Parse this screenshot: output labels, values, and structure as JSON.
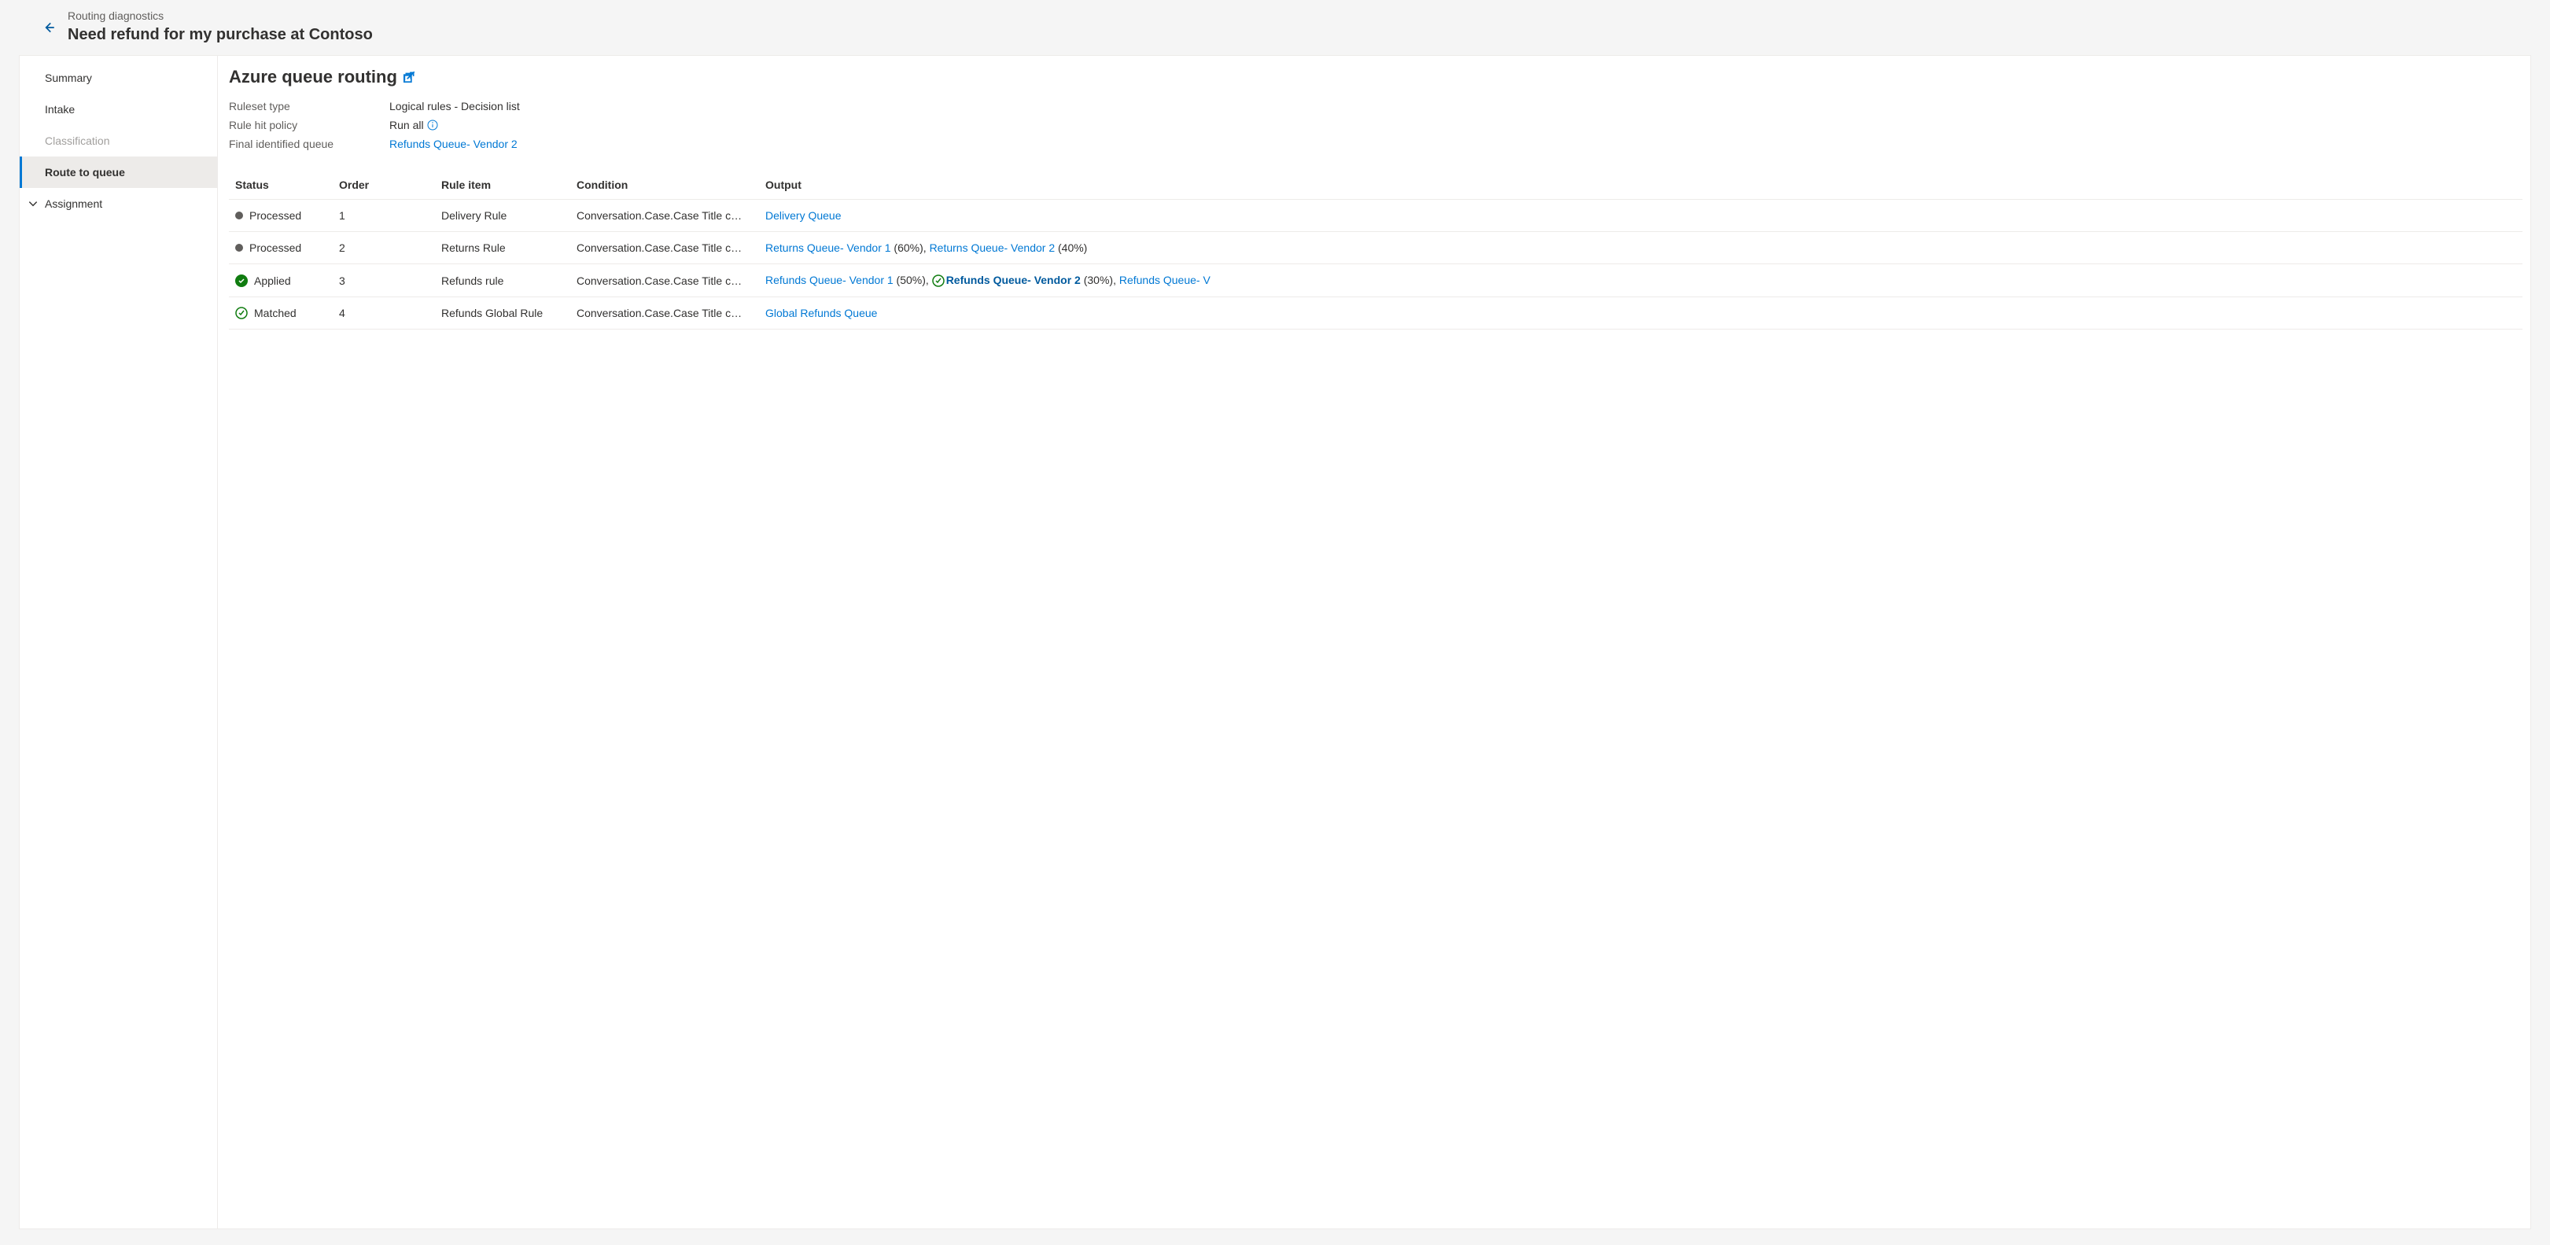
{
  "header": {
    "breadcrumb": "Routing diagnostics",
    "title": "Need refund for my purchase at Contoso"
  },
  "sidebar": {
    "items": [
      {
        "label": "Summary",
        "state": "normal",
        "chevron": false
      },
      {
        "label": "Intake",
        "state": "normal",
        "chevron": false
      },
      {
        "label": "Classification",
        "state": "disabled",
        "chevron": false
      },
      {
        "label": "Route to queue",
        "state": "selected",
        "chevron": false
      },
      {
        "label": "Assignment",
        "state": "normal",
        "chevron": true
      }
    ]
  },
  "content": {
    "title": "Azure queue routing",
    "meta": [
      {
        "label": "Ruleset type",
        "value": "Logical rules - Decision list",
        "link": false,
        "info": false
      },
      {
        "label": "Rule hit policy",
        "value": "Run all",
        "link": false,
        "info": true
      },
      {
        "label": "Final identified queue",
        "value": "Refunds Queue- Vendor 2",
        "link": true,
        "info": false
      }
    ],
    "columns": [
      "Status",
      "Order",
      "Rule item",
      "Condition",
      "Output"
    ],
    "rows": [
      {
        "status_icon": "dot",
        "status": "Processed",
        "order": "1",
        "rule": "Delivery Rule",
        "condition": "Conversation.Case.Case Title c…",
        "output": [
          {
            "text": "Delivery Queue",
            "link": true
          }
        ]
      },
      {
        "status_icon": "dot",
        "status": "Processed",
        "order": "2",
        "rule": "Returns Rule",
        "condition": "Conversation.Case.Case Title c…",
        "output": [
          {
            "text": "Returns Queue- Vendor 1",
            "link": true
          },
          {
            "text": " (60%), ",
            "link": false
          },
          {
            "text": "Returns Queue- Vendor 2",
            "link": true
          },
          {
            "text": " (40%)",
            "link": false
          }
        ]
      },
      {
        "status_icon": "check-solid",
        "status": "Applied",
        "order": "3",
        "rule": "Refunds rule",
        "condition": "Conversation.Case.Case Title c…",
        "output": [
          {
            "text": "Refunds Queue- Vendor 1",
            "link": true
          },
          {
            "text": " (50%), ",
            "link": false
          },
          {
            "icon": "check-outline"
          },
          {
            "text": "Refunds Queue- Vendor 2",
            "link": true,
            "bold": true
          },
          {
            "text": " (30%), ",
            "link": false
          },
          {
            "text": "Refunds Queue- V",
            "link": true
          }
        ]
      },
      {
        "status_icon": "check-outline",
        "status": "Matched",
        "order": "4",
        "rule": "Refunds Global Rule",
        "condition": "Conversation.Case.Case Title c…",
        "output": [
          {
            "text": "Global Refunds Queue",
            "link": true
          }
        ]
      }
    ]
  }
}
